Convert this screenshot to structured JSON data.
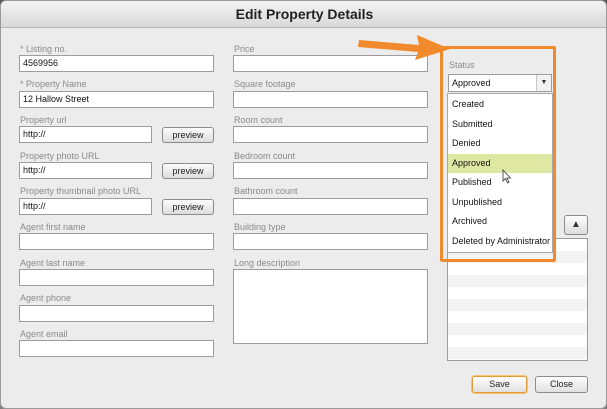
{
  "dialog": {
    "title": "Edit Property Details"
  },
  "left_column": {
    "listing_no": {
      "label": "* Listing no.",
      "value": "4569956"
    },
    "property_name": {
      "label": "* Property Name",
      "value": "12 Hallow Street"
    },
    "property_url": {
      "label": "Property url",
      "value": "http://",
      "button": "preview"
    },
    "property_photo_url": {
      "label": "Property photo URL",
      "value": "http://",
      "button": "preview"
    },
    "property_thumbnail_url": {
      "label": "Property thumbnail photo URL",
      "value": "http://",
      "button": "preview"
    },
    "agent_first_name": {
      "label": "Agent first name",
      "value": ""
    },
    "agent_last_name": {
      "label": "Agent last name",
      "value": ""
    },
    "agent_phone": {
      "label": "Agent phone",
      "value": ""
    },
    "agent_email": {
      "label": "Agent email",
      "value": ""
    }
  },
  "middle_column": {
    "price": {
      "label": "Price",
      "value": ""
    },
    "square_footage": {
      "label": "Square footage",
      "value": ""
    },
    "room_count": {
      "label": "Room count",
      "value": ""
    },
    "bedroom_count": {
      "label": "Bedroom count",
      "value": ""
    },
    "bathroom_count": {
      "label": "Bathroom count",
      "value": ""
    },
    "building_type": {
      "label": "Building type",
      "value": ""
    },
    "long_description": {
      "label": "Long description",
      "value": ""
    }
  },
  "status": {
    "label": "Status",
    "selected": "Approved",
    "options": [
      "Created",
      "Submitted",
      "Denied",
      "Approved",
      "Published",
      "Unpublished",
      "Archived",
      "Deleted by Administrator"
    ]
  },
  "footer": {
    "save": "Save",
    "close": "Close"
  },
  "colors": {
    "highlight": "#f08a2c",
    "selected_option": "#dfe8a2"
  },
  "icons": {
    "dropdown_arrow": "▼",
    "up_arrow": "▲"
  }
}
